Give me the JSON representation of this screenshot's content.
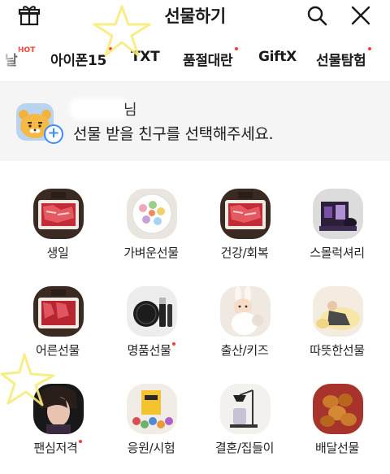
{
  "header": {
    "title": "선물하기",
    "left_icon": "gift-icon",
    "right_icons": [
      "search-icon",
      "close-icon"
    ]
  },
  "tabs": [
    {
      "label": "날",
      "badge": "HOT"
    },
    {
      "label": "아이폰15",
      "dot": true
    },
    {
      "label": "TXT"
    },
    {
      "label": "품절대란",
      "dot": true
    },
    {
      "label": "GiftX"
    },
    {
      "label": "선물탐험",
      "dot": true
    }
  ],
  "friend_select": {
    "name_suffix": "님",
    "prompt": "선물 받을 친구를 선택해주세요."
  },
  "categories": [
    {
      "label": "생일"
    },
    {
      "label": "가벼운선물"
    },
    {
      "label": "건강/회복"
    },
    {
      "label": "스몰럭셔리"
    },
    {
      "label": "어른선물"
    },
    {
      "label": "명품선물",
      "dot": true
    },
    {
      "label": "출산/키즈"
    },
    {
      "label": "따뜻한선물"
    },
    {
      "label": "팬심저격",
      "dot": true
    },
    {
      "label": "응원/시험"
    },
    {
      "label": "결혼/집들이"
    },
    {
      "label": "배달선물"
    }
  ]
}
